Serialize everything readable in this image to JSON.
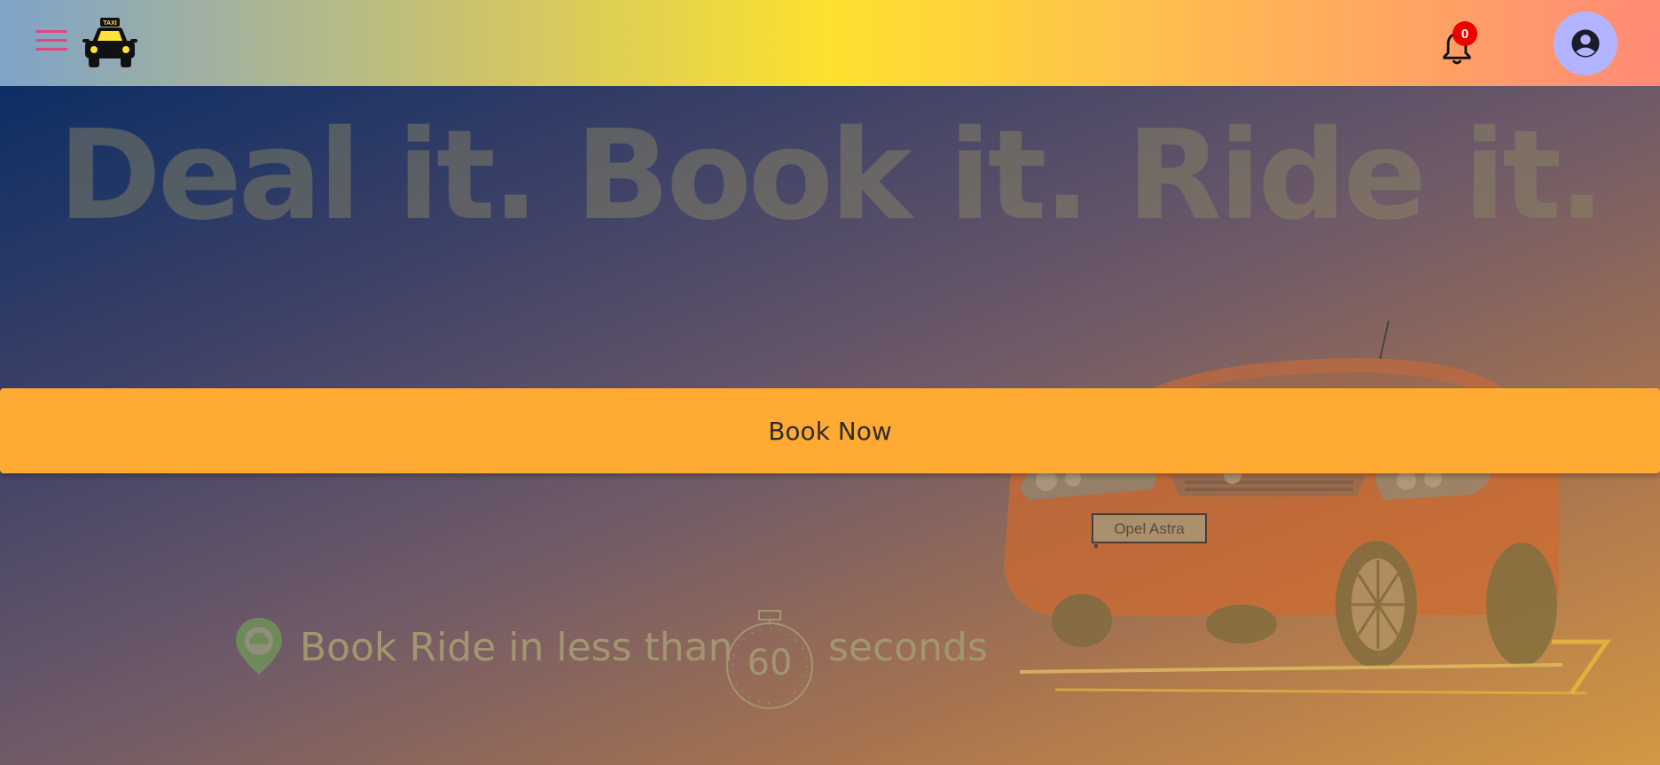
{
  "header": {
    "menu_icon": "hamburger-menu-icon",
    "logo_icon": "taxi-icon",
    "logo_sign": "TAXI",
    "notifications": {
      "icon": "bell-icon",
      "count": "0"
    },
    "account_icon": "account-circle-icon"
  },
  "hero": {
    "headline": "Deal it. Book it. Ride it.",
    "book_button": "Book Now",
    "car_plate": "Opel Astra",
    "tagline": {
      "prefix": "Book Ride in less than",
      "seconds": "60",
      "suffix": "seconds"
    }
  },
  "colors": {
    "book_button": "#ffab33",
    "badge": "#ee0000",
    "menu_icon": "#e0487f",
    "avatar_bg": "#b3b4ff"
  }
}
